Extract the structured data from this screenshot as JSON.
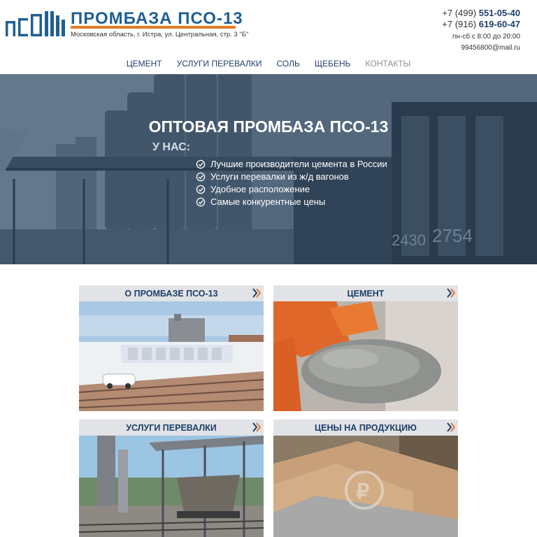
{
  "brand": {
    "name": "ПРОМБАЗА ПСО-13",
    "address": "Московская область, г. Истра, ул. Центральная, стр. 3 \"Б\""
  },
  "contacts": {
    "phone1_prefix": "+7 (499)",
    "phone1_number": "551-05-40",
    "phone2_prefix": "+7 (916)",
    "phone2_number": "619-60-47",
    "hours": "пн-сб с 8:00 до 20:00",
    "email": "99456800@mail.ru"
  },
  "nav": [
    {
      "label": "Цемент"
    },
    {
      "label": "Услуги перевалки"
    },
    {
      "label": "Соль"
    },
    {
      "label": "Щебень"
    },
    {
      "label": "Контакты"
    }
  ],
  "hero": {
    "title": "ОПТОВАЯ ПРОМБАЗА ПСО-13",
    "subtitle": "У НАС:",
    "features": [
      "Лучшие производители цемента в России",
      "Услуги перевалки из ж/д вагонов",
      "Удобное расположение",
      "Самые конкурентные цены"
    ],
    "wagon_numbers": [
      "2430",
      "2754"
    ]
  },
  "cards": [
    {
      "title": "О промбазе ПСО-13"
    },
    {
      "title": "Цемент"
    },
    {
      "title": "Услуги перевалки"
    },
    {
      "title": "Цены на продукцию"
    }
  ],
  "colors": {
    "brand_blue": "#1f5f93",
    "accent_orange": "#e27c2a",
    "nav_text": "#1f3f6b"
  }
}
